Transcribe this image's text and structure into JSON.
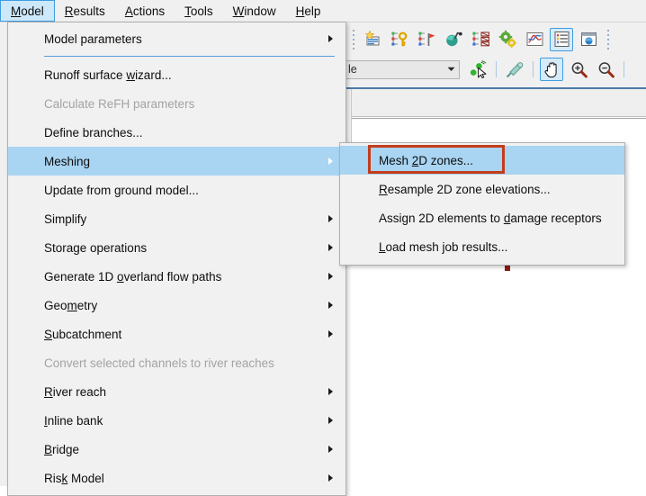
{
  "menubar": {
    "items": [
      {
        "label": "Model",
        "mnemonic": "M",
        "state": "open"
      },
      {
        "label": "Results",
        "mnemonic": "R",
        "state": "normal"
      },
      {
        "label": "Actions",
        "mnemonic": "A",
        "state": "normal"
      },
      {
        "label": "Tools",
        "mnemonic": "T",
        "state": "normal"
      },
      {
        "label": "Window",
        "mnemonic": "W",
        "state": "normal"
      },
      {
        "label": "Help",
        "mnemonic": "H",
        "state": "normal"
      }
    ]
  },
  "toolbar": {
    "row1_icons": [
      "new-model-icon",
      "key-node-icon",
      "flag-node-icon",
      "balloon-node-icon",
      "schedule-node-icon",
      "gears-icon",
      "graph-icon",
      "properties-grid-icon",
      "window-display-icon"
    ],
    "row2": {
      "combo_value": "le",
      "combo_placeholder": "",
      "select-nodes-icon": "select-nodes-icon",
      "pick-tool-icon": "pick-tool-icon",
      "pan-icon": "pan-icon",
      "zoom-in-icon": "zoom-in-icon",
      "zoom-out-icon": "zoom-out-icon"
    },
    "active_buttons": [
      "properties-grid-icon",
      "pan-icon"
    ]
  },
  "model_menu": {
    "items": [
      {
        "label": "Model parameters",
        "mnemonic": "",
        "submenu": true,
        "enabled": true,
        "selected": false,
        "separator_after": true
      },
      {
        "label": "Runoff surface wizard...",
        "mnemonic": "w",
        "submenu": false,
        "enabled": true,
        "selected": false,
        "separator_after": false
      },
      {
        "label": "Calculate ReFH parameters",
        "mnemonic": "",
        "submenu": false,
        "enabled": false,
        "selected": false,
        "separator_after": false
      },
      {
        "label": "Define branches...",
        "mnemonic": "",
        "submenu": false,
        "enabled": true,
        "selected": false,
        "separator_after": false
      },
      {
        "label": "Meshing",
        "mnemonic": "",
        "submenu": true,
        "enabled": true,
        "selected": true,
        "separator_after": false
      },
      {
        "label": "Update from ground model...",
        "mnemonic": "",
        "submenu": false,
        "enabled": true,
        "selected": false,
        "separator_after": false
      },
      {
        "label": "Simplify",
        "mnemonic": "",
        "submenu": true,
        "enabled": true,
        "selected": false,
        "separator_after": false
      },
      {
        "label": "Storage operations",
        "mnemonic": "",
        "submenu": true,
        "enabled": true,
        "selected": false,
        "separator_after": false
      },
      {
        "label": "Generate 1D overland flow paths",
        "mnemonic": "o",
        "submenu": true,
        "enabled": true,
        "selected": false,
        "separator_after": false
      },
      {
        "label": "Geometry",
        "mnemonic": "m",
        "submenu": true,
        "enabled": true,
        "selected": false,
        "separator_after": false
      },
      {
        "label": "Subcatchment",
        "mnemonic": "S",
        "submenu": true,
        "enabled": true,
        "selected": false,
        "separator_after": false
      },
      {
        "label": "Convert selected channels to river reaches",
        "mnemonic": "",
        "submenu": false,
        "enabled": false,
        "selected": false,
        "separator_after": false
      },
      {
        "label": "River reach",
        "mnemonic": "R",
        "submenu": true,
        "enabled": true,
        "selected": false,
        "separator_after": false
      },
      {
        "label": "Inline bank",
        "mnemonic": "I",
        "submenu": true,
        "enabled": true,
        "selected": false,
        "separator_after": false
      },
      {
        "label": "Bridge",
        "mnemonic": "B",
        "submenu": true,
        "enabled": true,
        "selected": false,
        "separator_after": false
      },
      {
        "label": "Risk Model",
        "mnemonic": "k",
        "submenu": true,
        "enabled": true,
        "selected": false,
        "separator_after": false
      }
    ]
  },
  "mesh_submenu": {
    "items": [
      {
        "label": "Mesh 2D zones...",
        "mnemonic": "2",
        "selected": true,
        "annotated": true
      },
      {
        "label": "Resample 2D zone elevations...",
        "mnemonic": "R",
        "selected": false,
        "annotated": false
      },
      {
        "label": "Assign 2D elements to damage receptors",
        "mnemonic": "d",
        "selected": false,
        "annotated": false
      },
      {
        "label": "Load mesh job results...",
        "mnemonic": "L",
        "selected": false,
        "annotated": false
      }
    ]
  },
  "annotation": {
    "name": "highlight-box",
    "color": "#c43c1b",
    "targets": "Mesh 2D zones..."
  },
  "colors": {
    "menu_background": "#f1f1f1",
    "menu_highlight": "#a9d4f2",
    "menubar_open": "#cde8fa",
    "accent_border": "#3f9de0",
    "separator": "#5b9bd5",
    "disabled_text": "#a3a3a3",
    "annotation_red": "#c43c1b",
    "canvas": "#ffffff"
  }
}
